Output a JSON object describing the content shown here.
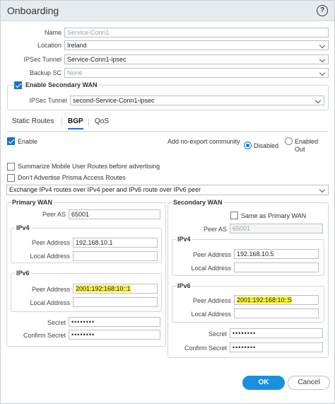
{
  "dialog": {
    "title": "Onboarding",
    "help_icon": "?"
  },
  "form": {
    "name_label": "Name",
    "name_placeholder": "Service-Conn1",
    "location_label": "Location",
    "location_value": "Ireland",
    "ipsec_label": "IPSec Tunnel",
    "ipsec_value": "Service-Conn1-ipsec",
    "backup_label": "Backup SC",
    "backup_value": "None",
    "secondary_wan_label": "Enable Secondary WAN",
    "secondary_wan_checked": true,
    "sec_ipsec_label": "IPSec Tunnel",
    "sec_ipsec_value": "second-Service-Conn1-ipsec"
  },
  "tabs": [
    {
      "label": "Static Routes",
      "active": false
    },
    {
      "label": "BGP",
      "active": true
    },
    {
      "label": "QoS",
      "active": false
    }
  ],
  "bgp": {
    "enable_label": "Enable",
    "enable_checked": true,
    "no_export_label": "Add no-export community",
    "disabled_label": "Disabled",
    "enabled_out_line1": "Enabled",
    "enabled_out_line2": "Out",
    "summarize_label": "Summarize Mobile User Routes before advertising",
    "dont_advertise_label": "Don't Advertise Prisma Access Routes",
    "exchange_value": "Exchange IPv4 routes over IPv4 peer and IPv6 route over IPv6 peer"
  },
  "primary": {
    "title": "Primary WAN",
    "peer_as_label": "Peer AS",
    "peer_as_value": "65001",
    "ipv4_title": "IPv4",
    "v4_peer_label": "Peer Address",
    "v4_peer_value": "192.168.10.1",
    "v4_local_label": "Local Address",
    "v4_local_value": "",
    "ipv6_title": "IPv6",
    "v6_peer_label": "Peer Address",
    "v6_peer_value": "2001:192:168:10::1",
    "v6_local_label": "Local Address",
    "v6_local_value": "",
    "secret_label": "Secret",
    "secret_value": "••••••••",
    "confirm_label": "Confirm Secret",
    "confirm_value": "••••••••"
  },
  "secondary": {
    "title": "Secondary WAN",
    "same_label": "Same as Primary WAN",
    "peer_as_label": "Peer AS",
    "peer_as_placeholder": "65001",
    "ipv4_title": "IPv4",
    "v4_peer_label": "Peer Address",
    "v4_peer_value": "192.168.10.5",
    "v4_local_label": "Local Address",
    "v4_local_value": "",
    "ipv6_title": "IPv6",
    "v6_peer_label": "Peer Address",
    "v6_peer_value": "2001:192:168:10::5",
    "v6_local_label": "Local Address",
    "v6_local_value": "",
    "secret_label": "Secret",
    "secret_value": "••••••••",
    "confirm_label": "Confirm Secret",
    "confirm_value": "••••••••"
  },
  "buttons": {
    "ok": "OK",
    "cancel": "Cancel"
  },
  "colors": {
    "accent": "#1a73c8",
    "highlight": "#fff53a"
  }
}
